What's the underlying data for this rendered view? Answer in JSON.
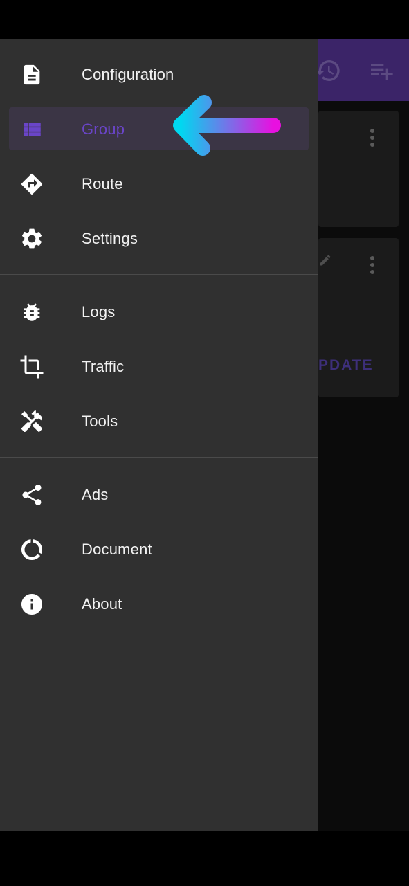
{
  "colors": {
    "drawer_bg": "#303030",
    "accent": "#6a45c8",
    "toolbar": "#3b2468",
    "arrow_start": "#00d8f0",
    "arrow_end": "#e810e0"
  },
  "background": {
    "update_label": "PDATE",
    "icons": [
      "history-icon",
      "playlist-add-icon",
      "pencil-icon",
      "more-vert-icon"
    ]
  },
  "drawer": {
    "section1": [
      {
        "label": "Configuration",
        "icon": "file-document-icon"
      },
      {
        "label": "Group",
        "icon": "list-icon",
        "active": true
      },
      {
        "label": "Route",
        "icon": "route-sign-icon"
      },
      {
        "label": "Settings",
        "icon": "gear-icon"
      }
    ],
    "section2": [
      {
        "label": "Logs",
        "icon": "bug-icon"
      },
      {
        "label": "Traffic",
        "icon": "crop-icon"
      },
      {
        "label": "Tools",
        "icon": "tools-icon"
      }
    ],
    "section3": [
      {
        "label": "Ads",
        "icon": "share-icon"
      },
      {
        "label": "Document",
        "icon": "donut-icon"
      },
      {
        "label": "About",
        "icon": "info-icon"
      }
    ]
  }
}
